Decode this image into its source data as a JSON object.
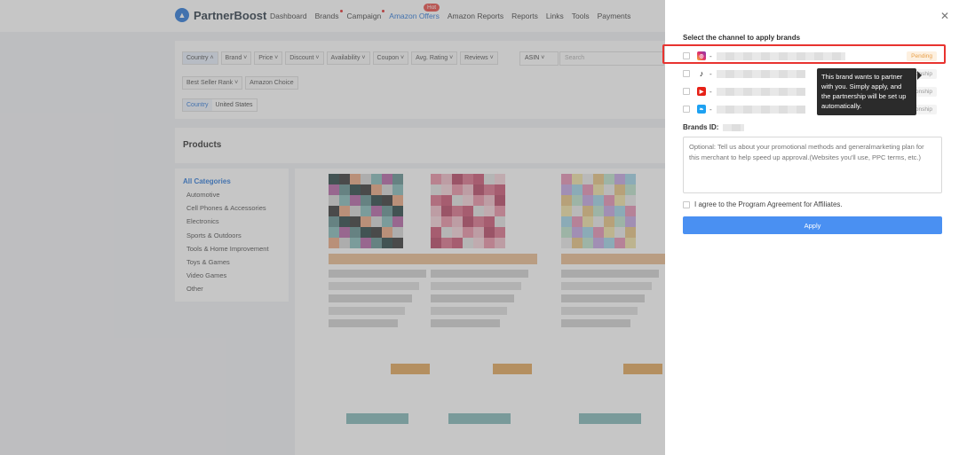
{
  "brand": {
    "name": "PartnerBoost",
    "logo_glyph": "▲"
  },
  "nav": {
    "items": [
      {
        "label": "Dashboard",
        "dot": false,
        "active": false
      },
      {
        "label": "Brands",
        "dot": true,
        "active": false
      },
      {
        "label": "Campaign",
        "dot": true,
        "active": false
      },
      {
        "label": "Amazon Offers",
        "dot": false,
        "active": true
      },
      {
        "label": "Amazon Reports",
        "dot": false,
        "active": false
      },
      {
        "label": "Reports",
        "dot": false,
        "active": false
      },
      {
        "label": "Links",
        "dot": false,
        "active": false
      },
      {
        "label": "Tools",
        "dot": false,
        "active": false
      },
      {
        "label": "Payments",
        "dot": false,
        "active": false
      }
    ],
    "hot_badge": "Hot"
  },
  "filters": {
    "row1": [
      "Country ˄",
      "Brand ˅",
      "Price ˅",
      "Discount ˅",
      "Availability ˅",
      "Coupon ˅",
      "Avg. Rating ˅",
      "Reviews ˅"
    ],
    "row2": [
      "Best Seller Rank ˅",
      "Amazon Choice"
    ],
    "asin_label": "ASIN ˅",
    "search_placeholder": "Search",
    "country_tag_key": "Country",
    "country_tag_value": "United States"
  },
  "products": {
    "title": "Products"
  },
  "categories": {
    "title": "All Categories",
    "items": [
      "Automotive",
      "Cell Phones & Accessories",
      "Electronics",
      "Sports & Outdoors",
      "Tools & Home Improvement",
      "Toys & Games",
      "Video Games",
      "Other"
    ]
  },
  "drawer": {
    "close_glyph": "✕",
    "section_label": "Select the channel to apply brands",
    "channels": [
      {
        "icon": "instagram-icon",
        "dash": "-",
        "status": "Pending",
        "status_kind": "pending"
      },
      {
        "icon": "tiktok-icon",
        "dash": "-",
        "status": "No Relationship",
        "status_kind": "norel"
      },
      {
        "icon": "youtube-icon",
        "dash": "-",
        "status": "No Relationship",
        "status_kind": "norel"
      },
      {
        "icon": "twitter-icon",
        "dash": "-",
        "status": "No Relationship",
        "status_kind": "norel"
      }
    ],
    "tooltip": "This brand wants to partner with you. Simply apply, and the partnership will be set up automatically.",
    "brands_id_label": "Brands ID:",
    "textarea_placeholder": "Optional: Tell us about your promotional methods and generalmarketing plan for this merchant to help speed up approval.(Websites you'll use, PPC terms, etc.)",
    "agree_label": "I agree to the Program Agreement for Affiliates.",
    "apply_label": "Apply"
  },
  "colors": {
    "accent": "#4a90f2",
    "highlight": "#e8332f",
    "pending": "#e8a04a"
  }
}
